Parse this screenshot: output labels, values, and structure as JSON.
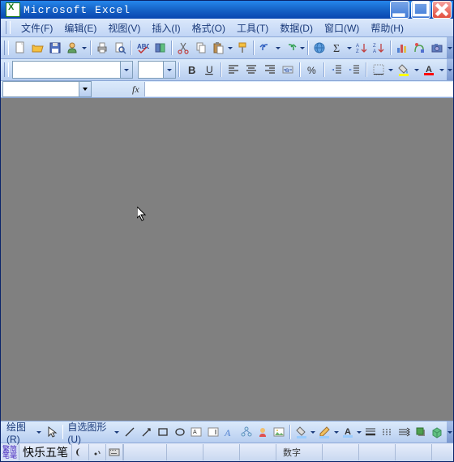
{
  "title": "Microsoft Excel",
  "menu": {
    "file": "文件(F)",
    "edit": "编辑(E)",
    "view": "视图(V)",
    "insert": "插入(I)",
    "format": "格式(O)",
    "tools": "工具(T)",
    "data": "数据(D)",
    "window": "窗口(W)",
    "help": "帮助(H)"
  },
  "namebox": {
    "value": "",
    "fx_label": "fx"
  },
  "formula": {
    "value": ""
  },
  "font": {
    "name": "",
    "size": ""
  },
  "draw": {
    "label": "绘图(R)",
    "autoshapes": "自选图形(U)"
  },
  "ime": {
    "indicator": "繁簡\n転笔",
    "name": "快乐五笔"
  },
  "status": {
    "numlock": "数字"
  }
}
